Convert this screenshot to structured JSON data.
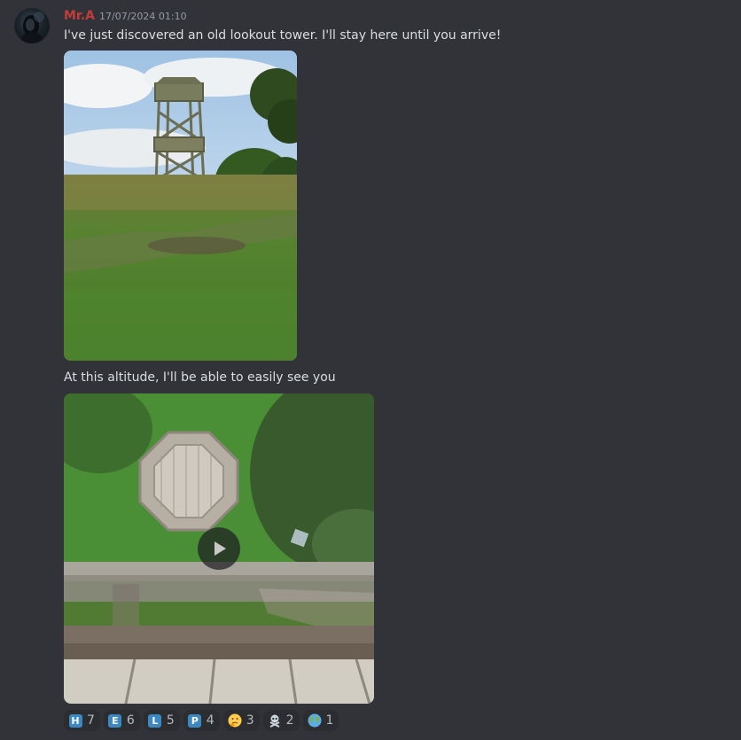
{
  "message": {
    "author": "Mr.A",
    "timestamp": "17/07/2024 01:10",
    "text1": "I've just discovered an old lookout tower. I'll stay here until you arrive!",
    "text2": "At this altitude, I'll be able to easily see you"
  },
  "colors": {
    "background": "#313338",
    "username": "#c33c3c",
    "timestamp": "#949ba4",
    "text": "#dbdee1",
    "reaction_bg": "#2b2d31",
    "keycap_blue": "#3b88c3"
  },
  "reactions": [
    {
      "emoji": "keycap-h",
      "glyph": "H",
      "count": "7"
    },
    {
      "emoji": "keycap-e",
      "glyph": "E",
      "count": "6"
    },
    {
      "emoji": "keycap-l",
      "glyph": "L",
      "count": "5"
    },
    {
      "emoji": "keycap-p",
      "glyph": "P",
      "count": "4"
    },
    {
      "emoji": "thinking-face",
      "glyph": "🤔",
      "count": "3"
    },
    {
      "emoji": "skull-crossbones",
      "glyph": "☠",
      "count": "2"
    },
    {
      "emoji": "globe",
      "glyph": "🌍",
      "count": "1"
    }
  ]
}
